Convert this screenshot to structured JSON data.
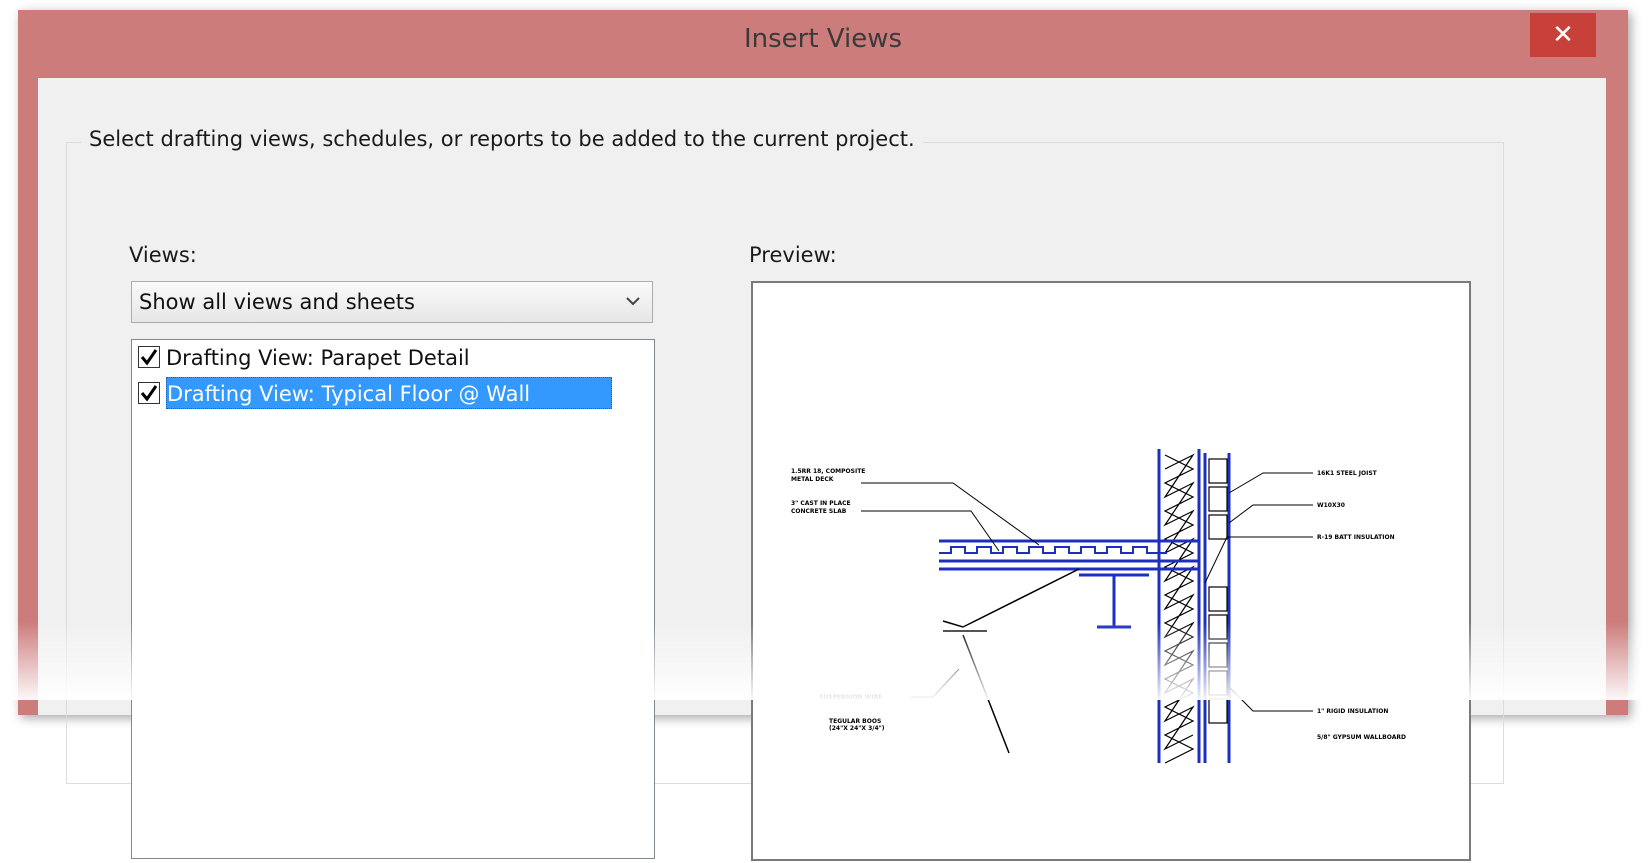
{
  "window": {
    "title": "Insert Views",
    "close_glyph": "✕"
  },
  "group": {
    "legend": "Select drafting views, schedules, or reports to be added to the current project."
  },
  "views": {
    "label": "Views:",
    "filter_value": "Show all views and sheets",
    "items": [
      {
        "label": "Drafting View: Parapet Detail",
        "checked": true,
        "selected": false
      },
      {
        "label": "Drafting View: Typical Floor @ Wall",
        "checked": true,
        "selected": true
      }
    ]
  },
  "preview": {
    "label": "Preview:",
    "annotations": {
      "deck": [
        "1.5RR 18, COMPOSITE",
        "METAL DECK"
      ],
      "slab": [
        "3\" CAST IN PLACE",
        "CONCRETE SLAB"
      ],
      "hanger": "SUSPENSION WIRE",
      "ceiling": [
        "TEGULAR BOOS",
        "(24\"X 24\"X 3/4\")"
      ],
      "joist": "16K1 STEEL JOIST",
      "beam": "W10X30",
      "batt": "R-19 BATT INSULATION",
      "rigid": "1\" RIGID INSULATION",
      "gypsum": "5/8\" GYPSUM WALLBOARD"
    }
  },
  "colors": {
    "titlebar": "#cd7c7c",
    "close": "#c7403a",
    "selection": "#3399ff",
    "detail_blue": "#1c2fbf"
  }
}
